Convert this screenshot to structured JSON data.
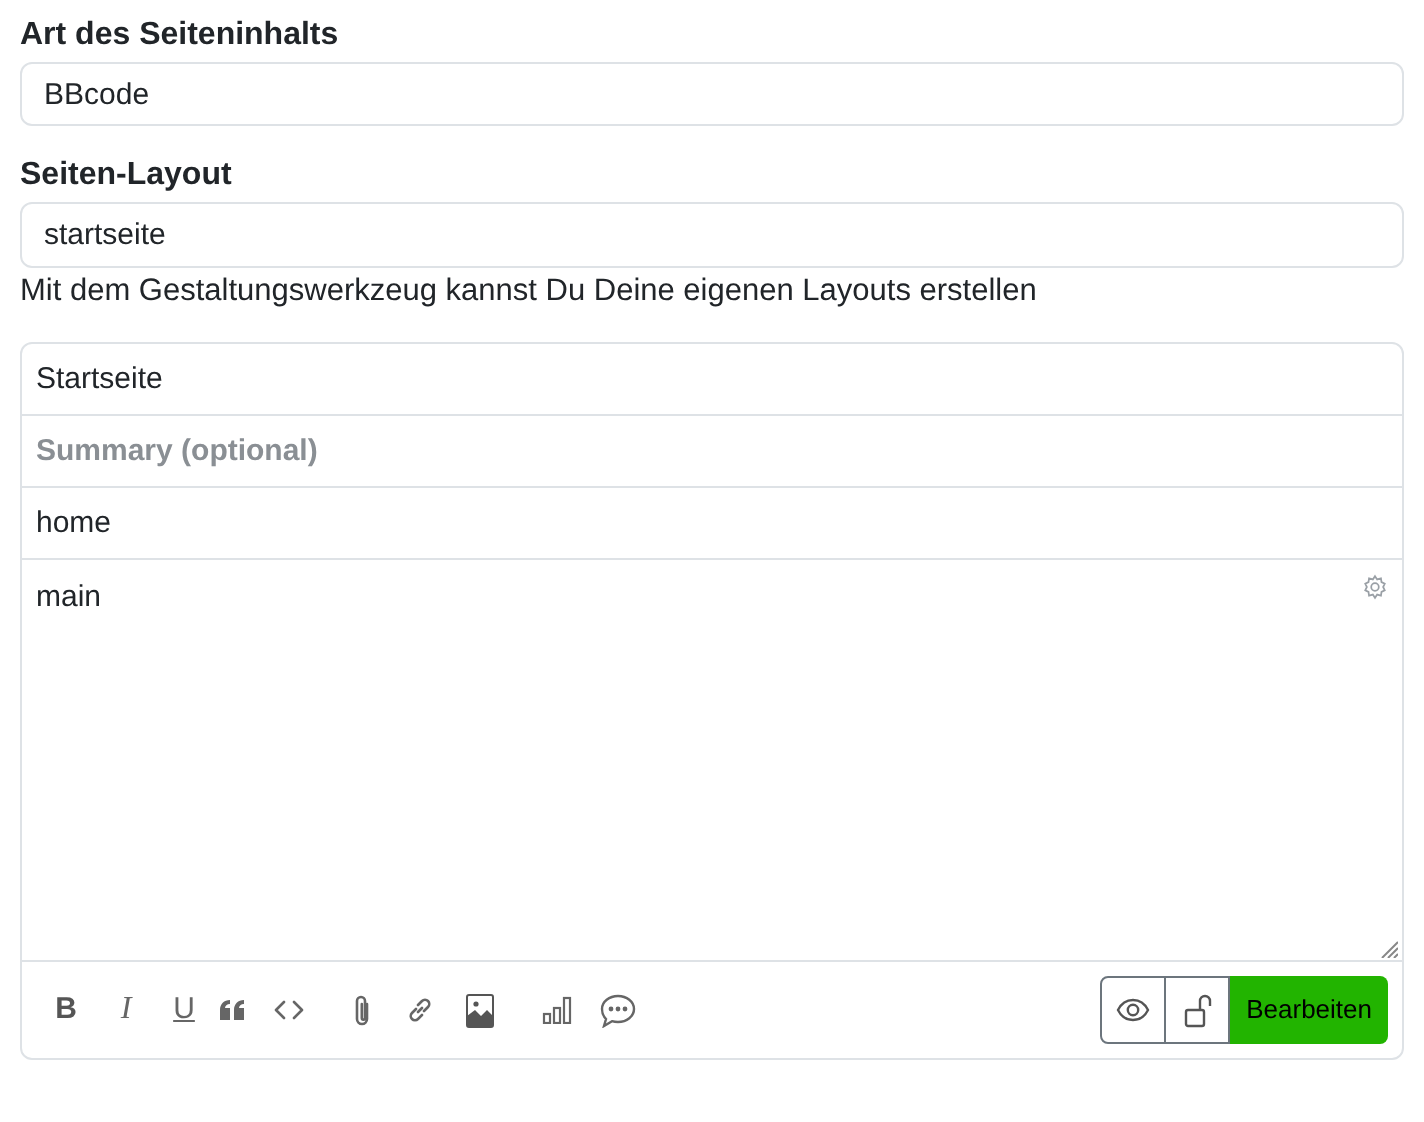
{
  "content_type": {
    "label": "Art des Seiteninhalts",
    "value": "BBcode"
  },
  "layout": {
    "label": "Seiten-Layout",
    "value": "startseite",
    "help": "Mit dem Gestaltungswerkzeug kannst Du Deine eigenen Layouts erstellen"
  },
  "editor": {
    "title": "Startseite",
    "summary_placeholder": "Summary (optional)",
    "slug": "home",
    "body": "main",
    "toolbar": [
      {
        "kind": "bold",
        "label": "B"
      },
      {
        "kind": "italic",
        "label": "I"
      },
      {
        "kind": "underline",
        "label": "U"
      },
      {
        "kind": "quote"
      },
      {
        "kind": "code"
      },
      {
        "kind": "attach"
      },
      {
        "kind": "link"
      },
      {
        "kind": "image"
      },
      {
        "kind": "chart"
      },
      {
        "kind": "comment"
      }
    ],
    "submit": "Bearbeiten"
  }
}
